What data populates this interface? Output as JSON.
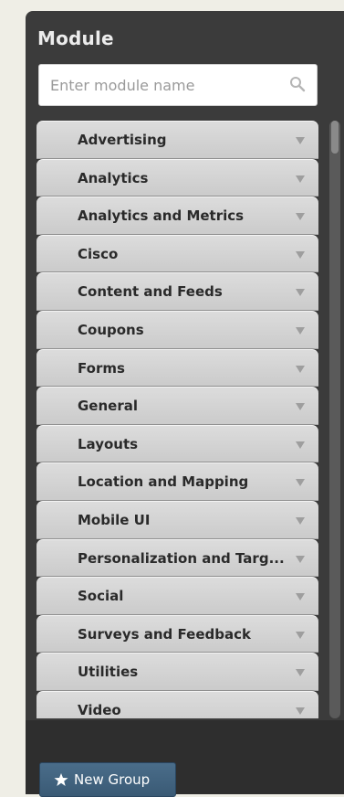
{
  "panel": {
    "title": "Module"
  },
  "search": {
    "placeholder": "Enter module name",
    "icon": "search-icon"
  },
  "groups": [
    {
      "label": "Advertising"
    },
    {
      "label": "Analytics"
    },
    {
      "label": "Analytics and Metrics"
    },
    {
      "label": "Cisco"
    },
    {
      "label": "Content and Feeds"
    },
    {
      "label": "Coupons"
    },
    {
      "label": "Forms"
    },
    {
      "label": "General"
    },
    {
      "label": "Layouts"
    },
    {
      "label": "Location and Mapping"
    },
    {
      "label": "Mobile UI"
    },
    {
      "label": "Personalization and Targ..."
    },
    {
      "label": "Social"
    },
    {
      "label": "Surveys and Feedback"
    },
    {
      "label": "Utilities"
    },
    {
      "label": "Video"
    }
  ],
  "footer": {
    "new_group_label": "New Group",
    "new_group_icon": "star-icon"
  },
  "colors": {
    "panel_bg": "#3b3b3b",
    "item_bg": "#d4d4d4",
    "button_bg": "#426480"
  }
}
